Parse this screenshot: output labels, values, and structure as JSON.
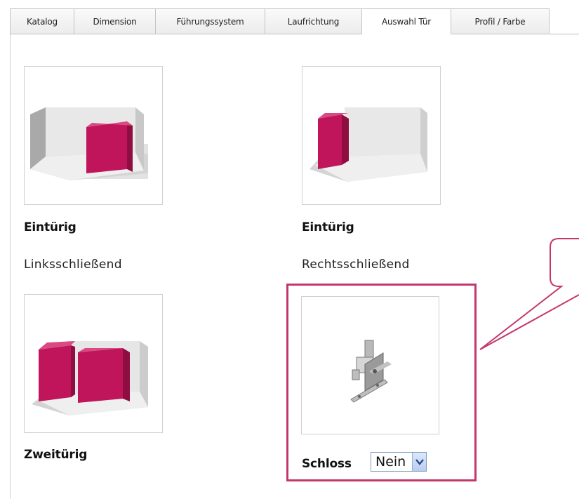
{
  "tabs": [
    {
      "label": "Katalog",
      "active": false
    },
    {
      "label": "Dimension",
      "active": false
    },
    {
      "label": "Führungssystem",
      "active": false
    },
    {
      "label": "Laufrichtung",
      "active": false
    },
    {
      "label": "Auswahl Tür",
      "active": true
    },
    {
      "label": "Profil / Farbe",
      "active": false
    }
  ],
  "options": {
    "left": {
      "title": "Eintürig",
      "subtitle": "Linksschließend"
    },
    "right": {
      "title": "Eintürig",
      "subtitle": "Rechtsschließend"
    },
    "double": {
      "title": "Zweitürig"
    }
  },
  "lock": {
    "label": "Schloss",
    "select_value": "Nein"
  },
  "colors": {
    "door": "#c0155a",
    "highlight": "#c4366c"
  }
}
